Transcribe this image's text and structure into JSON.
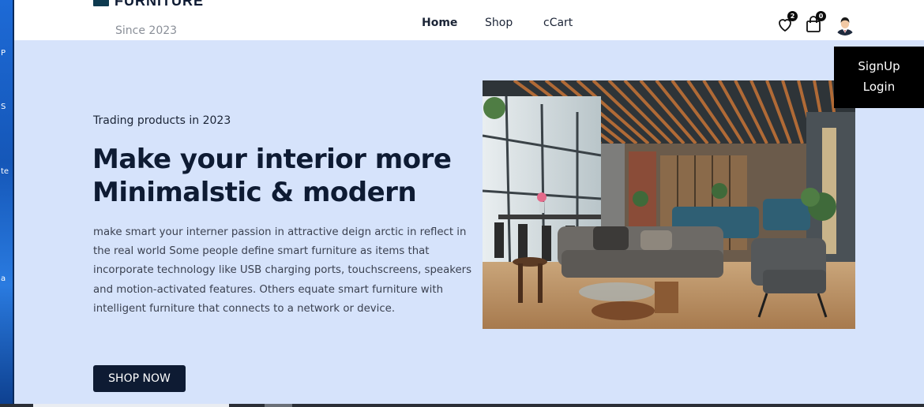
{
  "desktop": {
    "fragments": [
      "P",
      "S",
      "te",
      "a"
    ]
  },
  "header": {
    "logo_text": "FURNITURE",
    "since": "Since 2023",
    "nav": {
      "home": "Home",
      "shop": "Shop",
      "cart": "cCart"
    },
    "wishlist_count": "2",
    "cart_count": "0"
  },
  "auth_menu": {
    "signup": "SignUp",
    "login": "Login"
  },
  "hero": {
    "eyebrow": "Trading products in 2023",
    "headline": "Make your interior more Minimalstic & modern",
    "body": "make smart your interner passion in attractive deign arctic in reflect in the real world Some people define smart furniture as items that incorporate technology like USB charging ports, touchscreens, speakers and motion-activated features. Others equate smart furniture with intelligent furniture that connects to a network or device.",
    "cta": "SHOP NOW"
  },
  "colors": {
    "hero_bg": "#d6e3fb",
    "navy": "#0e1b33",
    "auth_bg": "#000000"
  }
}
